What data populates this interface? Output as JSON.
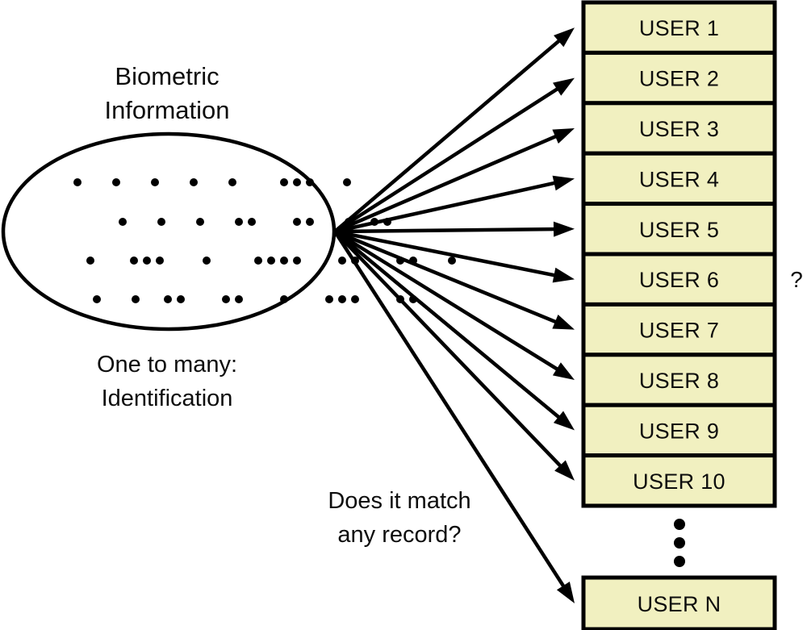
{
  "diagram": {
    "title": "Biometric Information",
    "title_lines": [
      "Biometric",
      "Information"
    ],
    "caption_lines": [
      "One to many:",
      "Identification"
    ],
    "question_lines": [
      "Does it match",
      "any record?"
    ],
    "unknown_marker": "?",
    "vertical_ellipsis": "⋮",
    "source_node": {
      "name": "biometric-information-ellipse",
      "label": "Biometric Information",
      "shape": "ellipse",
      "fill_color": "#ffffff",
      "stroke_color": "#000000",
      "dot_rows": [
        [
          96,
          144,
          192,
          240,
          288,
          352,
          368,
          384,
          430
        ],
        [
          152,
          200,
          248,
          296,
          312,
          368,
          384,
          432,
          464,
          480
        ],
        [
          112,
          166,
          182,
          198,
          256,
          320,
          336,
          352,
          368,
          424,
          440,
          496,
          512,
          560
        ],
        [
          120,
          168,
          208,
          224,
          280,
          296,
          352,
          408,
          424,
          440,
          496,
          512
        ]
      ]
    },
    "records": [
      {
        "id": "user-1",
        "label": "USER 1"
      },
      {
        "id": "user-2",
        "label": "USER 2"
      },
      {
        "id": "user-3",
        "label": "USER 3"
      },
      {
        "id": "user-4",
        "label": "USER 4"
      },
      {
        "id": "user-5",
        "label": "USER 5"
      },
      {
        "id": "user-6",
        "label": "USER 6"
      },
      {
        "id": "user-7",
        "label": "USER 7"
      },
      {
        "id": "user-8",
        "label": "USER 8"
      },
      {
        "id": "user-9",
        "label": "USER 9"
      },
      {
        "id": "user-10",
        "label": "USER 10"
      },
      {
        "id": "user-n",
        "label": "USER N"
      }
    ],
    "record_fill_color": "#f1f0c0",
    "record_stroke_color": "#000000",
    "arrow_count": 11,
    "arrow_color": "#000000",
    "background_color": "#ffffff"
  }
}
